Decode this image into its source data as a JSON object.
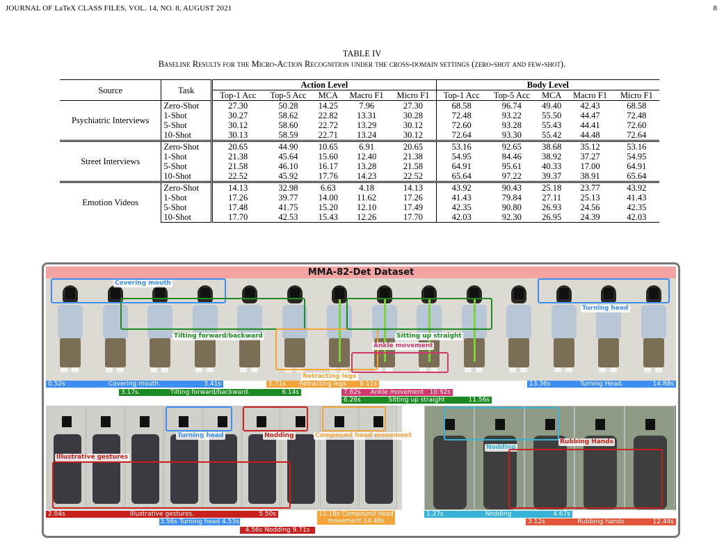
{
  "header": {
    "left": "JOURNAL OF LaTeX CLASS FILES, VOL. 14, NO. 8, AUGUST 2021",
    "page": "8"
  },
  "caption": {
    "label": "TABLE IV",
    "text": "Baseline Results for the Micro-Action Recognition under the cross-domain settings (zero-shot and few-shot)."
  },
  "table": {
    "col_source": "Source",
    "col_task": "Task",
    "group_action": "Action Level",
    "group_body": "Body Level",
    "metrics": [
      "Top-1 Acc",
      "Top-5 Acc",
      "MCA",
      "Macro F1",
      "Micro F1"
    ],
    "groups": [
      {
        "source": "Psychiatric Interviews",
        "rows": [
          {
            "task": "Zero-Shot",
            "vals": [
              "27.30",
              "50.28",
              "14.25",
              "7.96",
              "27.30",
              "68.58",
              "96.74",
              "49.40",
              "42.43",
              "68.58"
            ]
          },
          {
            "task": "1-Shot",
            "vals": [
              "30.27",
              "58.62",
              "22.82",
              "13.31",
              "30.28",
              "72.48",
              "93.22",
              "55.50",
              "44.47",
              "72.48"
            ]
          },
          {
            "task": "5-Shot",
            "vals": [
              "30.12",
              "58.60",
              "22.72",
              "13.29",
              "30.12",
              "72.60",
              "93.28",
              "55.43",
              "44.41",
              "72.60"
            ]
          },
          {
            "task": "10-Shot",
            "vals": [
              "30.13",
              "58.59",
              "22.71",
              "13.24",
              "30.12",
              "72.64",
              "93.30",
              "55.42",
              "44.48",
              "72.64"
            ]
          }
        ]
      },
      {
        "source": "Street Interviews",
        "rows": [
          {
            "task": "Zero-Shot",
            "vals": [
              "20.65",
              "44.90",
              "10.65",
              "6.91",
              "20.65",
              "53.16",
              "92.65",
              "38.68",
              "35.12",
              "53.16"
            ]
          },
          {
            "task": "1-Shot",
            "vals": [
              "21.38",
              "45.64",
              "15.60",
              "12.40",
              "21.38",
              "54.95",
              "84.46",
              "38.92",
              "37.27",
              "54.95"
            ]
          },
          {
            "task": "5-Shot",
            "vals": [
              "21.58",
              "46.10",
              "16.17",
              "13.28",
              "21.58",
              "64.91",
              "95.61",
              "40.33",
              "17.00",
              "64.91"
            ]
          },
          {
            "task": "10-Shot",
            "vals": [
              "22.52",
              "45.92",
              "17.76",
              "14.23",
              "22.52",
              "65.64",
              "97.22",
              "39.37",
              "38.91",
              "65.64"
            ]
          }
        ]
      },
      {
        "source": "Emotion Videos",
        "rows": [
          {
            "task": "Zero-Shot",
            "vals": [
              "14.13",
              "32.98",
              "6.63",
              "4.18",
              "14.13",
              "43.92",
              "90.43",
              "25.18",
              "23.77",
              "43.92"
            ]
          },
          {
            "task": "1-Shot",
            "vals": [
              "17.26",
              "39.77",
              "14.00",
              "11.62",
              "17.26",
              "41.43",
              "79.84",
              "27.11",
              "25.13",
              "41.43"
            ]
          },
          {
            "task": "5-Shot",
            "vals": [
              "17.48",
              "41.75",
              "15.20",
              "12.10",
              "17.49",
              "42.35",
              "90.80",
              "26.93",
              "24.56",
              "42.35"
            ]
          },
          {
            "task": "10-Shot",
            "vals": [
              "17.70",
              "42.53",
              "15.43",
              "12.26",
              "17.70",
              "42.03",
              "92.30",
              "26.95",
              "24.39",
              "42.03"
            ]
          }
        ]
      }
    ]
  },
  "figure": {
    "title": "MMA-82-Det Dataset",
    "labels": {
      "covering_mouth": "Covering mouth",
      "tilting": "Tilting forward/backward",
      "retracting": "Retracting legs",
      "sitting_up": "Sitting up straight",
      "ankle": "Ankle movement",
      "turning_head": "Turning head",
      "turning_head2": "Turning head",
      "nodding": "Nodding",
      "compound": "Compound head movement",
      "illustrative": "Illustrative gestures",
      "nodding2": "Nodding",
      "rubbing": "Rubbing Hands"
    },
    "bars": {
      "b1": {
        "l": "0.52s",
        "c": "Covering mouth.",
        "r": "3.41s"
      },
      "b2": {
        "l": "3.17s.",
        "c": "Tilting forward/backward.",
        "r": "6.14s"
      },
      "b3": {
        "l": "5.71s",
        "c": "Retracting legs",
        "r": "8.11s"
      },
      "b4": {
        "l": "7.62s",
        "c": "Ankle movement",
        "r": "10.92s"
      },
      "b5": {
        "l": "6.26s",
        "c": "Sitting up straight",
        "r": "11.56s"
      },
      "b6": {
        "l": "13.36s",
        "c": "Turning Head.",
        "r": "14.88s"
      },
      "b7": {
        "l": "2.04s",
        "c": "Illustrative gestures.",
        "r": "5.50s"
      },
      "b8": {
        "c": "3.56s Turning head 4.53s"
      },
      "b9": {
        "c": "4.56s  Nodding  9.71s"
      },
      "b10": {
        "c": "11.18s  Compound head",
        "c2": "movement  14.48s"
      },
      "b11": {
        "l": "1.27s",
        "c": "Nodding",
        "r": "4.67s"
      },
      "b12": {
        "l": "3.12s",
        "c": "Rubbing hands",
        "r": "12.44s"
      }
    },
    "colors": {
      "blue": "#3d8ef0",
      "green": "#1b8a22",
      "orange": "#f2a33a",
      "pink": "#d0386c",
      "red": "#c8201c",
      "cyan": "#38b2d6",
      "bannerRed": "#f4a3a3"
    }
  }
}
